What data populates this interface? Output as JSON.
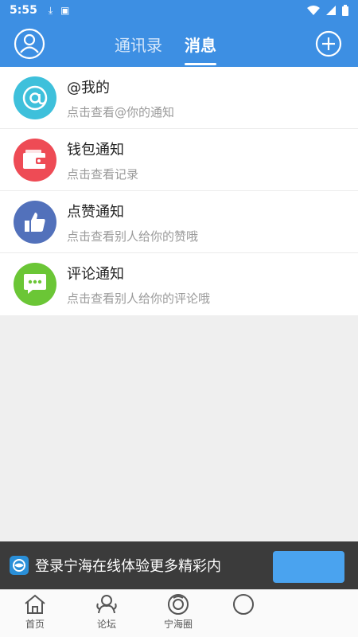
{
  "status_bar": {
    "time": "5:55"
  },
  "header": {
    "tabs": [
      {
        "label": "通讯录",
        "active": false
      },
      {
        "label": "消息",
        "active": true
      }
    ]
  },
  "notifications": [
    {
      "title": "@我的",
      "subtitle": "点击查看@你的通知",
      "icon": "at-icon",
      "color": "#3ec0db"
    },
    {
      "title": "钱包通知",
      "subtitle": "点击查看记录",
      "icon": "wallet-icon",
      "color": "#ee4b55"
    },
    {
      "title": "点赞通知",
      "subtitle": "点击查看别人给你的赞哦",
      "icon": "thumbs-up-icon",
      "color": "#5271bb"
    },
    {
      "title": "评论通知",
      "subtitle": "点击查看别人给你的评论哦",
      "icon": "comment-icon",
      "color": "#6bc636"
    }
  ],
  "login_banner": {
    "text": "登录宁海在线体验更多精彩内"
  },
  "bottom_nav": [
    {
      "label": "首页",
      "icon": "home-icon"
    },
    {
      "label": "论坛",
      "icon": "forum-icon"
    },
    {
      "label": "宁海圈",
      "icon": "circle-icon"
    }
  ],
  "colors": {
    "primary": "#3d8fe3",
    "banner": "#3b3b3b",
    "background": "#efefef"
  }
}
